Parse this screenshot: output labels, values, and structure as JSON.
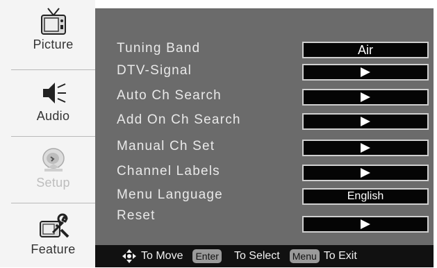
{
  "sidebar": {
    "tabs": [
      {
        "label": "Picture",
        "icon": "tv-icon"
      },
      {
        "label": "Audio",
        "icon": "speaker-icon"
      },
      {
        "label": "Setup",
        "icon": "satellite-dish-icon"
      },
      {
        "label": "Feature",
        "icon": "tv-wrench-icon"
      }
    ],
    "active": "Setup"
  },
  "menu": {
    "items": [
      {
        "label": "Tuning Band",
        "value": "Air"
      },
      {
        "label": "DTV-Signal",
        "value": "arrow"
      },
      {
        "label": "Auto Ch Search",
        "value": "arrow"
      },
      {
        "label": "Add On Ch Search",
        "value": "arrow"
      },
      {
        "label": "Manual Ch Set",
        "value": "arrow"
      },
      {
        "label": "Channel Labels",
        "value": "arrow"
      },
      {
        "label": "Menu Language",
        "value": "English"
      },
      {
        "label": "Reset",
        "value": "arrow"
      }
    ]
  },
  "hints": {
    "move": "To Move",
    "enter_key": "Enter",
    "select": "To Select",
    "menu_key": "Menu",
    "exit": "To Exit"
  },
  "colors": {
    "panel": "#6b6b6b",
    "value_box": "#050505",
    "hint_bar": "#111111"
  }
}
